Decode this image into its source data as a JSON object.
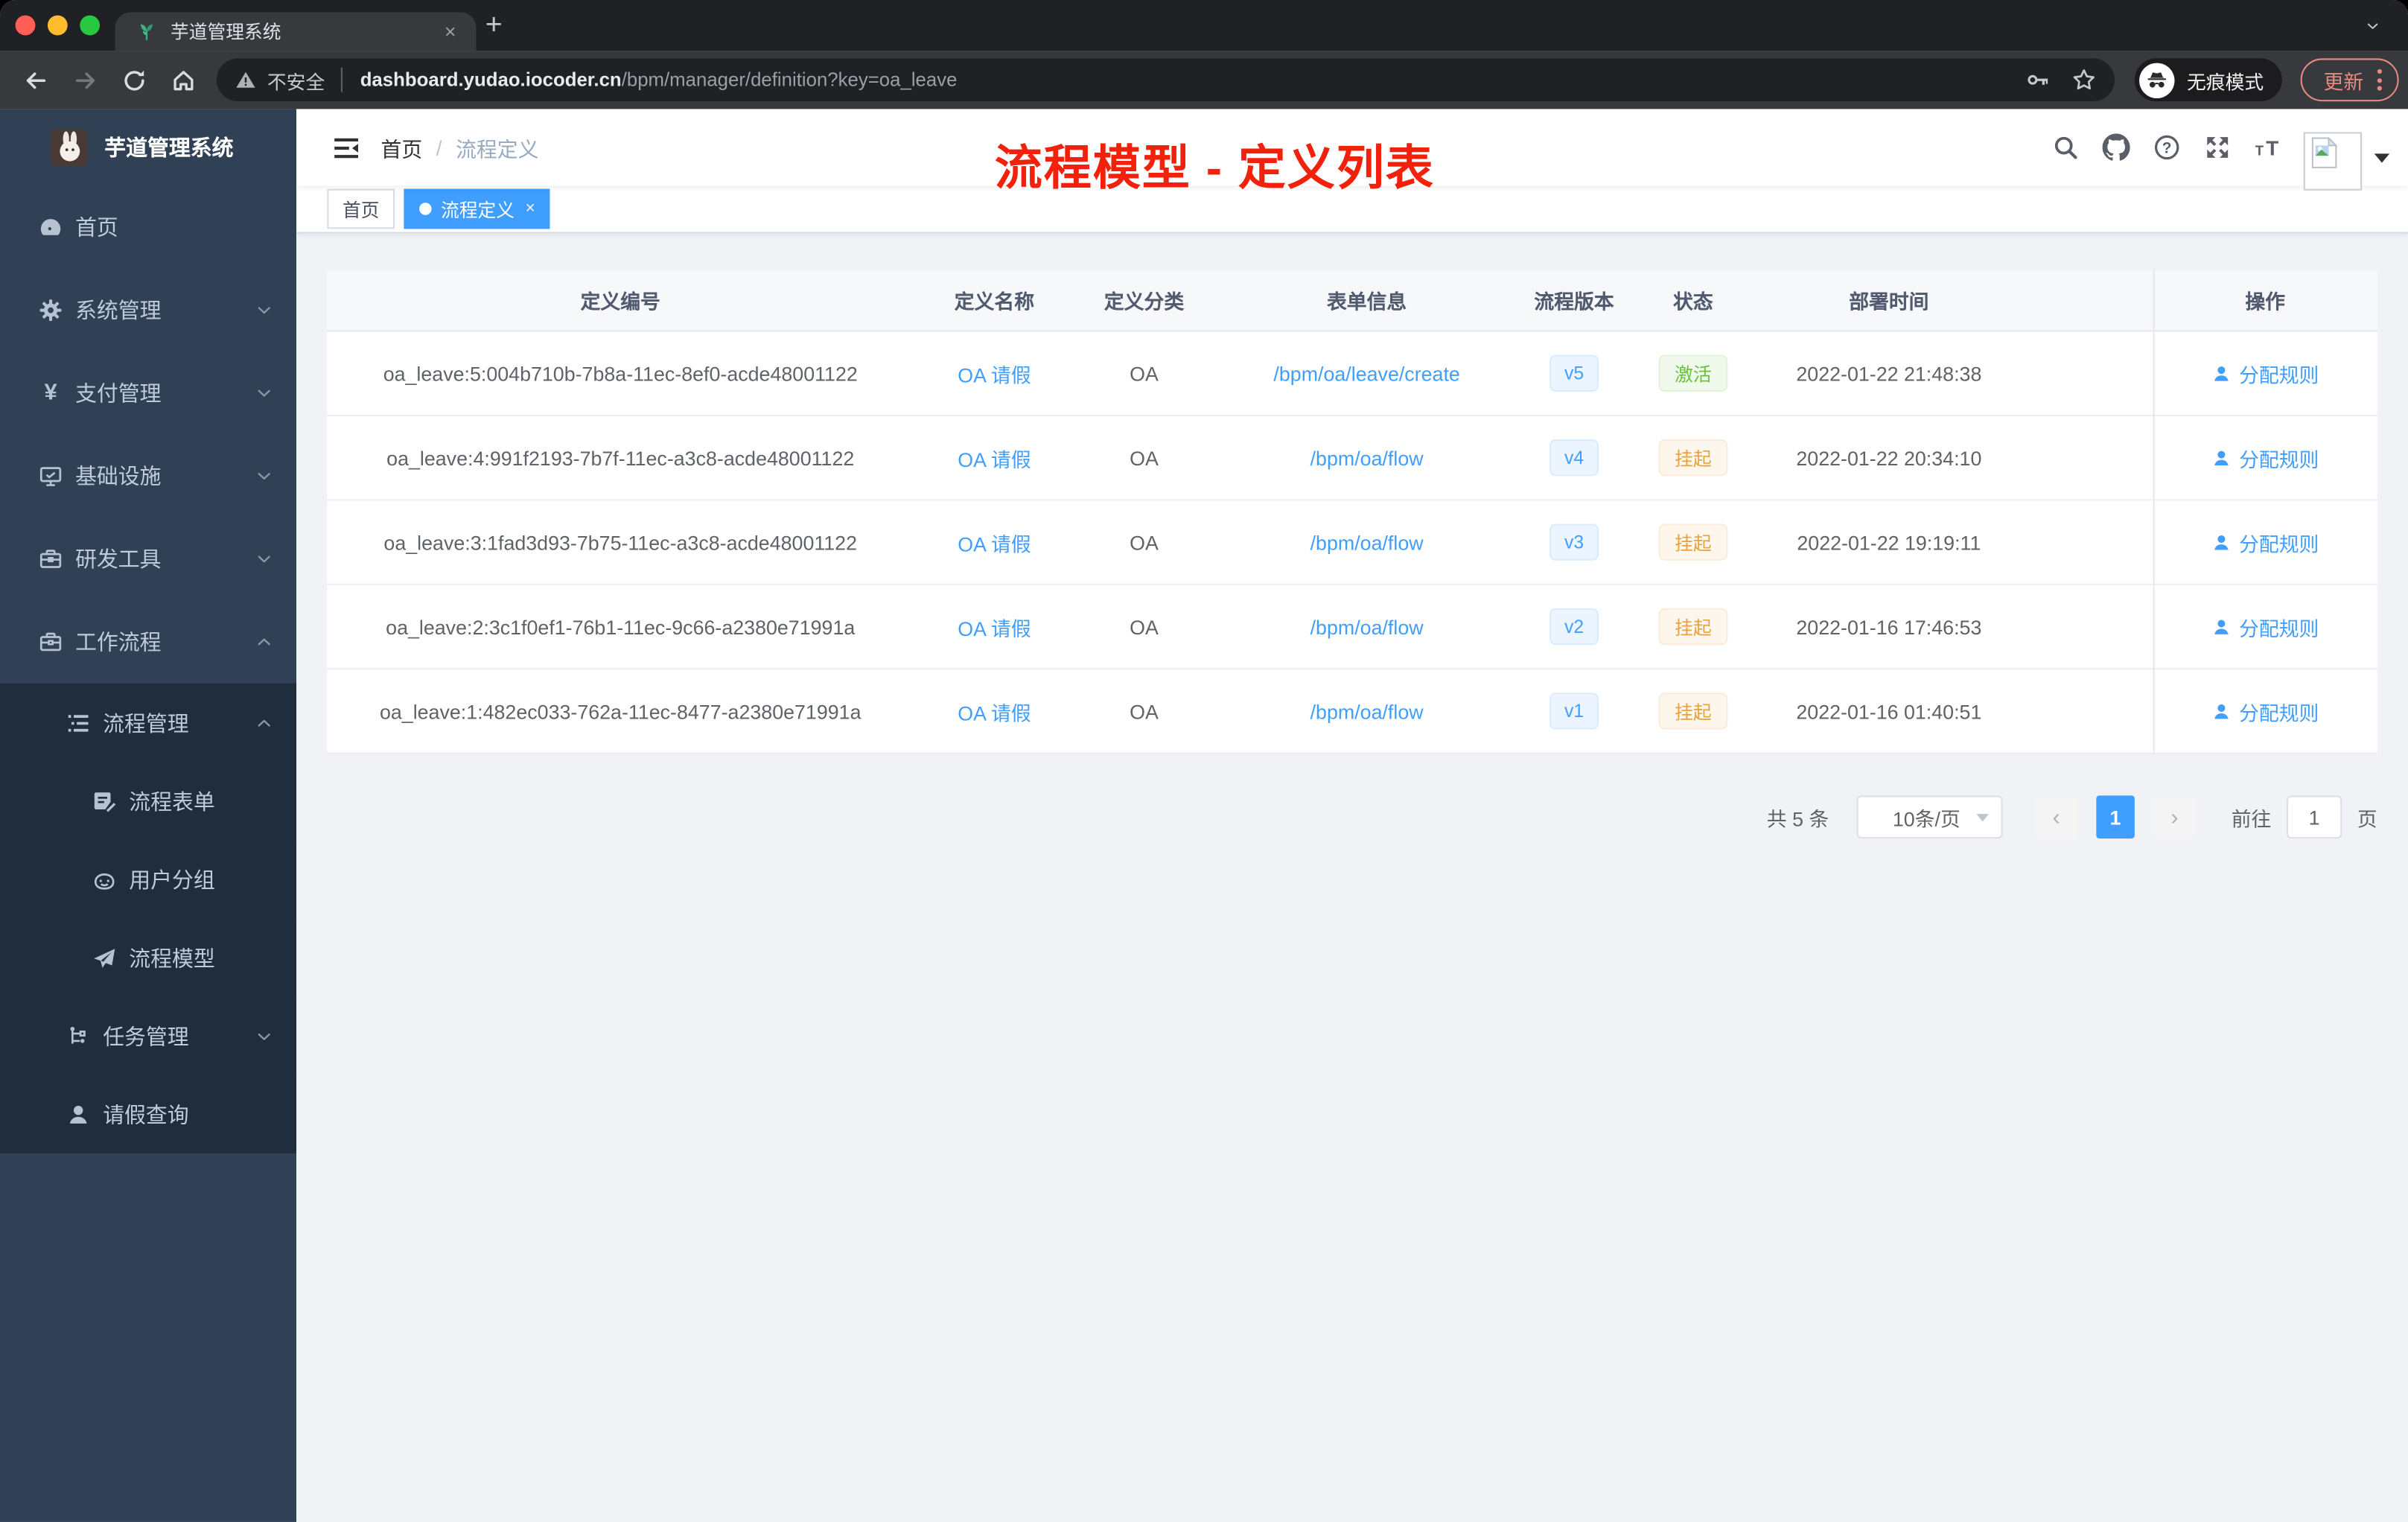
{
  "browser": {
    "tab": {
      "title": "芋道管理系统",
      "close_glyph": "×",
      "new_tab_glyph": "+"
    },
    "toolbar": {
      "security_label": "不安全",
      "url_host": "dashboard.yudao.iocoder.cn",
      "url_path": "/bpm/manager/definition?key=oa_leave",
      "incognito_label": "无痕模式",
      "update_label": "更新"
    }
  },
  "sidebar": {
    "app_title": "芋道管理系统",
    "menu": [
      {
        "label": "首页",
        "icon": "dashboard",
        "level": 1,
        "dark": false,
        "chevron": ""
      },
      {
        "label": "系统管理",
        "icon": "gear",
        "level": 1,
        "dark": false,
        "chevron": "down"
      },
      {
        "label": "支付管理",
        "icon": "yen",
        "level": 1,
        "dark": false,
        "chevron": "down"
      },
      {
        "label": "基础设施",
        "icon": "monitor",
        "level": 1,
        "dark": false,
        "chevron": "down"
      },
      {
        "label": "研发工具",
        "icon": "toolbox",
        "level": 1,
        "dark": false,
        "chevron": "down"
      },
      {
        "label": "工作流程",
        "icon": "briefcase",
        "level": 1,
        "dark": false,
        "chevron": "up"
      },
      {
        "label": "流程管理",
        "icon": "list-tree",
        "level": 2,
        "dark": true,
        "chevron": "up"
      },
      {
        "label": "流程表单",
        "icon": "form-edit",
        "level": 3,
        "dark": true,
        "chevron": ""
      },
      {
        "label": "用户分组",
        "icon": "user-group",
        "level": 3,
        "dark": true,
        "chevron": ""
      },
      {
        "label": "流程模型",
        "icon": "paper-plane",
        "level": 3,
        "dark": true,
        "chevron": ""
      },
      {
        "label": "任务管理",
        "icon": "org-tree",
        "level": 2,
        "dark": true,
        "chevron": "down"
      },
      {
        "label": "请假查询",
        "icon": "person",
        "level": 2,
        "dark": true,
        "chevron": ""
      }
    ]
  },
  "navbar": {
    "breadcrumb": {
      "root": "首页",
      "separator": "/",
      "current": "流程定义"
    }
  },
  "annotation": {
    "text": "流程模型 - 定义列表",
    "color": "#f2210c"
  },
  "tags_view": [
    {
      "label": "首页",
      "active": false,
      "closable": false,
      "close_glyph": ""
    },
    {
      "label": "流程定义",
      "active": true,
      "closable": true,
      "close_glyph": "×"
    }
  ],
  "table": {
    "columns": [
      "定义编号",
      "定义名称",
      "定义分类",
      "表单信息",
      "流程版本",
      "状态",
      "部署时间",
      "操作"
    ],
    "rows": [
      {
        "id": "oa_leave:5:004b710b-7b8a-11ec-8ef0-acde48001122",
        "name": "OA 请假",
        "category": "OA",
        "form": "/bpm/oa/leave/create",
        "version": "v5",
        "status": "激活",
        "status_type": "success",
        "deploy_time": "2022-01-22 21:48:38",
        "action": "分配规则"
      },
      {
        "id": "oa_leave:4:991f2193-7b7f-11ec-a3c8-acde48001122",
        "name": "OA 请假",
        "category": "OA",
        "form": "/bpm/oa/flow",
        "version": "v4",
        "status": "挂起",
        "status_type": "warning",
        "deploy_time": "2022-01-22 20:34:10",
        "action": "分配规则"
      },
      {
        "id": "oa_leave:3:1fad3d93-7b75-11ec-a3c8-acde48001122",
        "name": "OA 请假",
        "category": "OA",
        "form": "/bpm/oa/flow",
        "version": "v3",
        "status": "挂起",
        "status_type": "warning",
        "deploy_time": "2022-01-22 19:19:11",
        "action": "分配规则"
      },
      {
        "id": "oa_leave:2:3c1f0ef1-76b1-11ec-9c66-a2380e71991a",
        "name": "OA 请假",
        "category": "OA",
        "form": "/bpm/oa/flow",
        "version": "v2",
        "status": "挂起",
        "status_type": "warning",
        "deploy_time": "2022-01-16 17:46:53",
        "action": "分配规则"
      },
      {
        "id": "oa_leave:1:482ec033-762a-11ec-8477-a2380e71991a",
        "name": "OA 请假",
        "category": "OA",
        "form": "/bpm/oa/flow",
        "version": "v1",
        "status": "挂起",
        "status_type": "warning",
        "deploy_time": "2022-01-16 01:40:51",
        "action": "分配规则"
      }
    ]
  },
  "pagination": {
    "total": "共 5 条",
    "page_size": "10条/页",
    "prev_glyph": "‹",
    "current_page": "1",
    "next_glyph": "›",
    "goto_label": "前往",
    "goto_value": "1",
    "unit_label": "页"
  },
  "colors": {
    "primary": "#409eff",
    "success": "#67c23a",
    "warning": "#e6a23c",
    "sidebar_bg": "#304156",
    "sidebar_sub_bg": "#1f2d3d",
    "annotation_red": "#f2210c"
  }
}
